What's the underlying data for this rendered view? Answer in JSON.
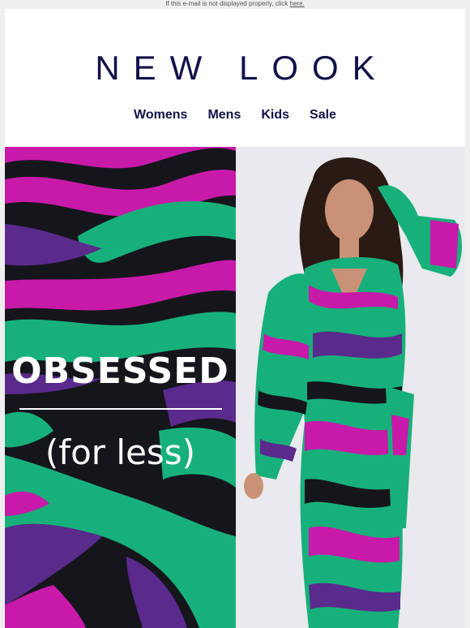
{
  "preheader": {
    "text": "If this e-mail is not displayed properly, click ",
    "link": "here."
  },
  "brand": {
    "logo": "NEW LOOK",
    "color": "#12124a"
  },
  "nav": {
    "items": [
      "Womens",
      "Mens",
      "Kids",
      "Sale"
    ]
  },
  "hero": {
    "headline": "OBSESSED",
    "subheadline": "(for less)",
    "image_left": "green-purple-pink-wave-print",
    "image_right": "model-in-printed-wrap-dress",
    "colors": {
      "green": "#18b07a",
      "magenta": "#c71aa8",
      "purple": "#5a2a8c",
      "black": "#15151c"
    }
  }
}
